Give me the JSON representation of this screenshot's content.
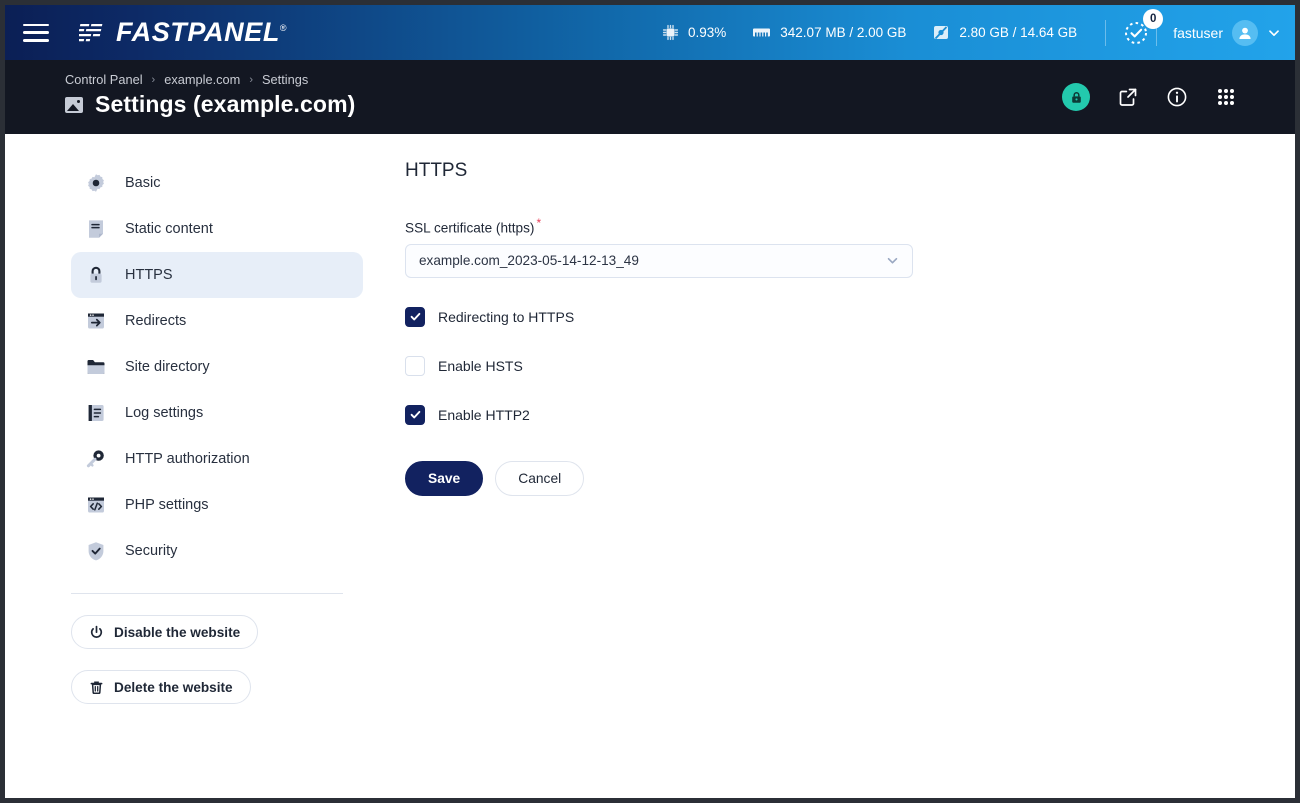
{
  "topbar": {
    "menu_icon": "hamburger-icon",
    "brand": "FASTPANEL",
    "brand_reg": "®",
    "stats": [
      {
        "icon": "cpu-icon",
        "value": "0.93%"
      },
      {
        "icon": "ram-icon",
        "value": "342.07 MB / 2.00 GB"
      },
      {
        "icon": "disk-icon",
        "value": "2.80 GB / 14.64 GB"
      }
    ],
    "tasks": {
      "icon": "task-check-icon",
      "badge": "0"
    },
    "user": {
      "name": "fastuser",
      "avatar_icon": "user-avatar-icon",
      "chevron_icon": "chevron-down-icon"
    }
  },
  "header": {
    "breadcrumb": [
      {
        "label": "Control Panel"
      },
      {
        "label": "example.com"
      },
      {
        "label": "Settings"
      }
    ],
    "breadcrumb_separator": "›",
    "title": "Settings (example.com)",
    "title_icon": "site-thumbnail-icon",
    "actions": [
      {
        "icon": "lock-shield-icon",
        "accent": "#23c9ad"
      },
      {
        "icon": "external-link-icon"
      },
      {
        "icon": "info-circle-icon"
      },
      {
        "icon": "apps-grid-icon"
      }
    ]
  },
  "sidebar": {
    "items": [
      {
        "label": "Basic",
        "icon": "gear-icon",
        "active": false
      },
      {
        "label": "Static content",
        "icon": "document-icon",
        "active": false
      },
      {
        "label": "HTTPS",
        "icon": "lock-icon",
        "active": true
      },
      {
        "label": "Redirects",
        "icon": "redirect-arrow-icon",
        "active": false
      },
      {
        "label": "Site directory",
        "icon": "folder-icon",
        "active": false
      },
      {
        "label": "Log settings",
        "icon": "log-list-icon",
        "active": false
      },
      {
        "label": "HTTP authorization",
        "icon": "key-icon",
        "active": false
      },
      {
        "label": "PHP settings",
        "icon": "code-window-icon",
        "active": false
      },
      {
        "label": "Security",
        "icon": "shield-check-icon",
        "active": false
      }
    ],
    "actions": [
      {
        "label": "Disable the website",
        "icon": "power-icon"
      },
      {
        "label": "Delete the website",
        "icon": "trash-icon"
      }
    ]
  },
  "main": {
    "section_title": "HTTPS",
    "ssl_field": {
      "label": "SSL certificate (https)",
      "required_marker": "*",
      "value": "example.com_2023-05-14-12-13_49",
      "chevron_icon": "chevron-down-icon"
    },
    "checkboxes": [
      {
        "label": "Redirecting to HTTPS",
        "checked": true
      },
      {
        "label": "Enable HSTS",
        "checked": false
      },
      {
        "label": "Enable HTTP2",
        "checked": true
      }
    ],
    "buttons": {
      "save": "Save",
      "cancel": "Cancel"
    }
  },
  "colors": {
    "accent_navy": "#122260",
    "accent_teal": "#23c9ad",
    "topbar_gradient_start": "#0b1f55",
    "topbar_gradient_end": "#22a3ea",
    "active_nav_bg": "#e7eef8",
    "required_red": "#e8415a"
  }
}
